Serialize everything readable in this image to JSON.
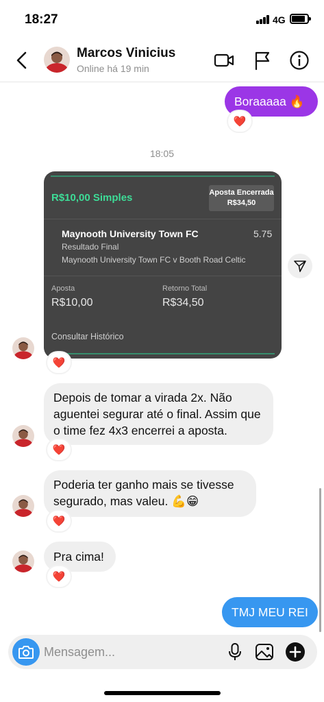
{
  "status_bar": {
    "time": "18:27",
    "network": "4G",
    "battery_level": 0.85
  },
  "header": {
    "contact_name": "Marcos Vinicius",
    "contact_status": "Online há 19 min",
    "icons": [
      "back-icon",
      "video-call-icon",
      "flag-icon",
      "info-icon"
    ]
  },
  "messages": {
    "outgoing_1": "Boraaaaa 🔥",
    "time_separator": "18:05",
    "incoming_1": "Depois de tomar a virada 2x. Não aguentei segurar até o final. Assim que o time fez 4x3 encerrei a aposta.",
    "incoming_2": "Poderia ter ganho mais se tivesse segurado, mas valeu. 💪😁",
    "incoming_3": "Pra cima!",
    "outgoing_2": "TMJ MEU REI",
    "reaction": "❤️"
  },
  "bet_card": {
    "type_label": "R$10,00 Simples",
    "badge_title": "Aposta Encerrada",
    "badge_value": "R$34,50",
    "selection": "Maynooth University Town FC",
    "odds": "5.75",
    "market": "Resultado Final",
    "event": "Maynooth University Town FC v Booth Road Celtic",
    "stake_label": "Aposta",
    "stake_value": "R$10,00",
    "return_label": "Retorno Total",
    "return_value": "R$34,50",
    "history_link": "Consultar Histórico"
  },
  "composer": {
    "placeholder": "Mensagem...",
    "value": ""
  },
  "colors": {
    "outgoing": "#3797f0",
    "purple": "#9b36e6",
    "incoming": "#efefef",
    "bet_accent": "#3ddc97",
    "card": "#444444"
  }
}
